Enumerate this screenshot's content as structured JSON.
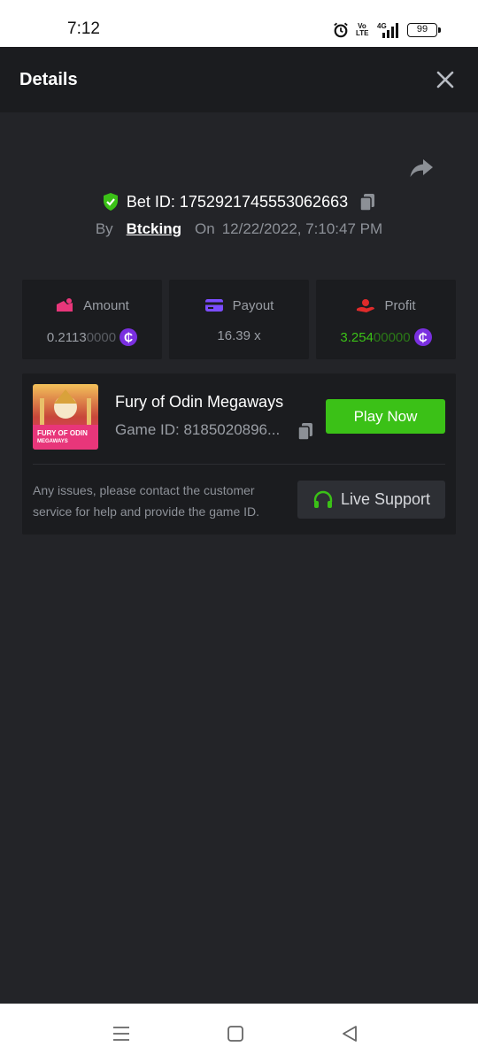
{
  "status_bar": {
    "time": "7:12",
    "network": "4G",
    "volte": "Vo LTE",
    "battery": "99",
    "icons": [
      "alarm-icon",
      "volte-icon",
      "signal-icon",
      "battery-icon"
    ]
  },
  "header": {
    "title": "Details",
    "close_icon": "close-icon"
  },
  "bet": {
    "id_label": "Bet ID: 1752921745553062663",
    "by_label": "By",
    "username": "Btcking",
    "on_label": "On",
    "datetime": "12/22/2022, 7:10:47 PM"
  },
  "stats": [
    {
      "label": "Amount",
      "value_main": "0.2113",
      "value_dim": "0000",
      "icon": "amount-icon",
      "currency_icon": "coin-icon",
      "color": "#e8367a"
    },
    {
      "label": "Payout",
      "value_main": "16.39 x",
      "value_dim": "",
      "icon": "card-icon",
      "color": "#7c4dff"
    },
    {
      "label": "Profit",
      "value_main": "3.254",
      "value_dim": "00000",
      "icon": "profit-icon",
      "currency_icon": "coin-icon",
      "color": "#e02b2b"
    }
  ],
  "game": {
    "name": "Fury of Odin Megaways",
    "id_label": "Game ID: 8185020896...",
    "thumb_text_1": "FURY OF ODIN",
    "thumb_text_2": "MEGAWAYS",
    "play_label": "Play Now",
    "issue_text": "Any issues, please contact the customer service for help and provide the game ID.",
    "support_label": "Live Support"
  },
  "colors": {
    "accent_green": "#3bc117",
    "profit_green": "#3bc117",
    "coin_purple": "#7a2fe0",
    "background": "#232428",
    "card": "#1b1c1f"
  }
}
